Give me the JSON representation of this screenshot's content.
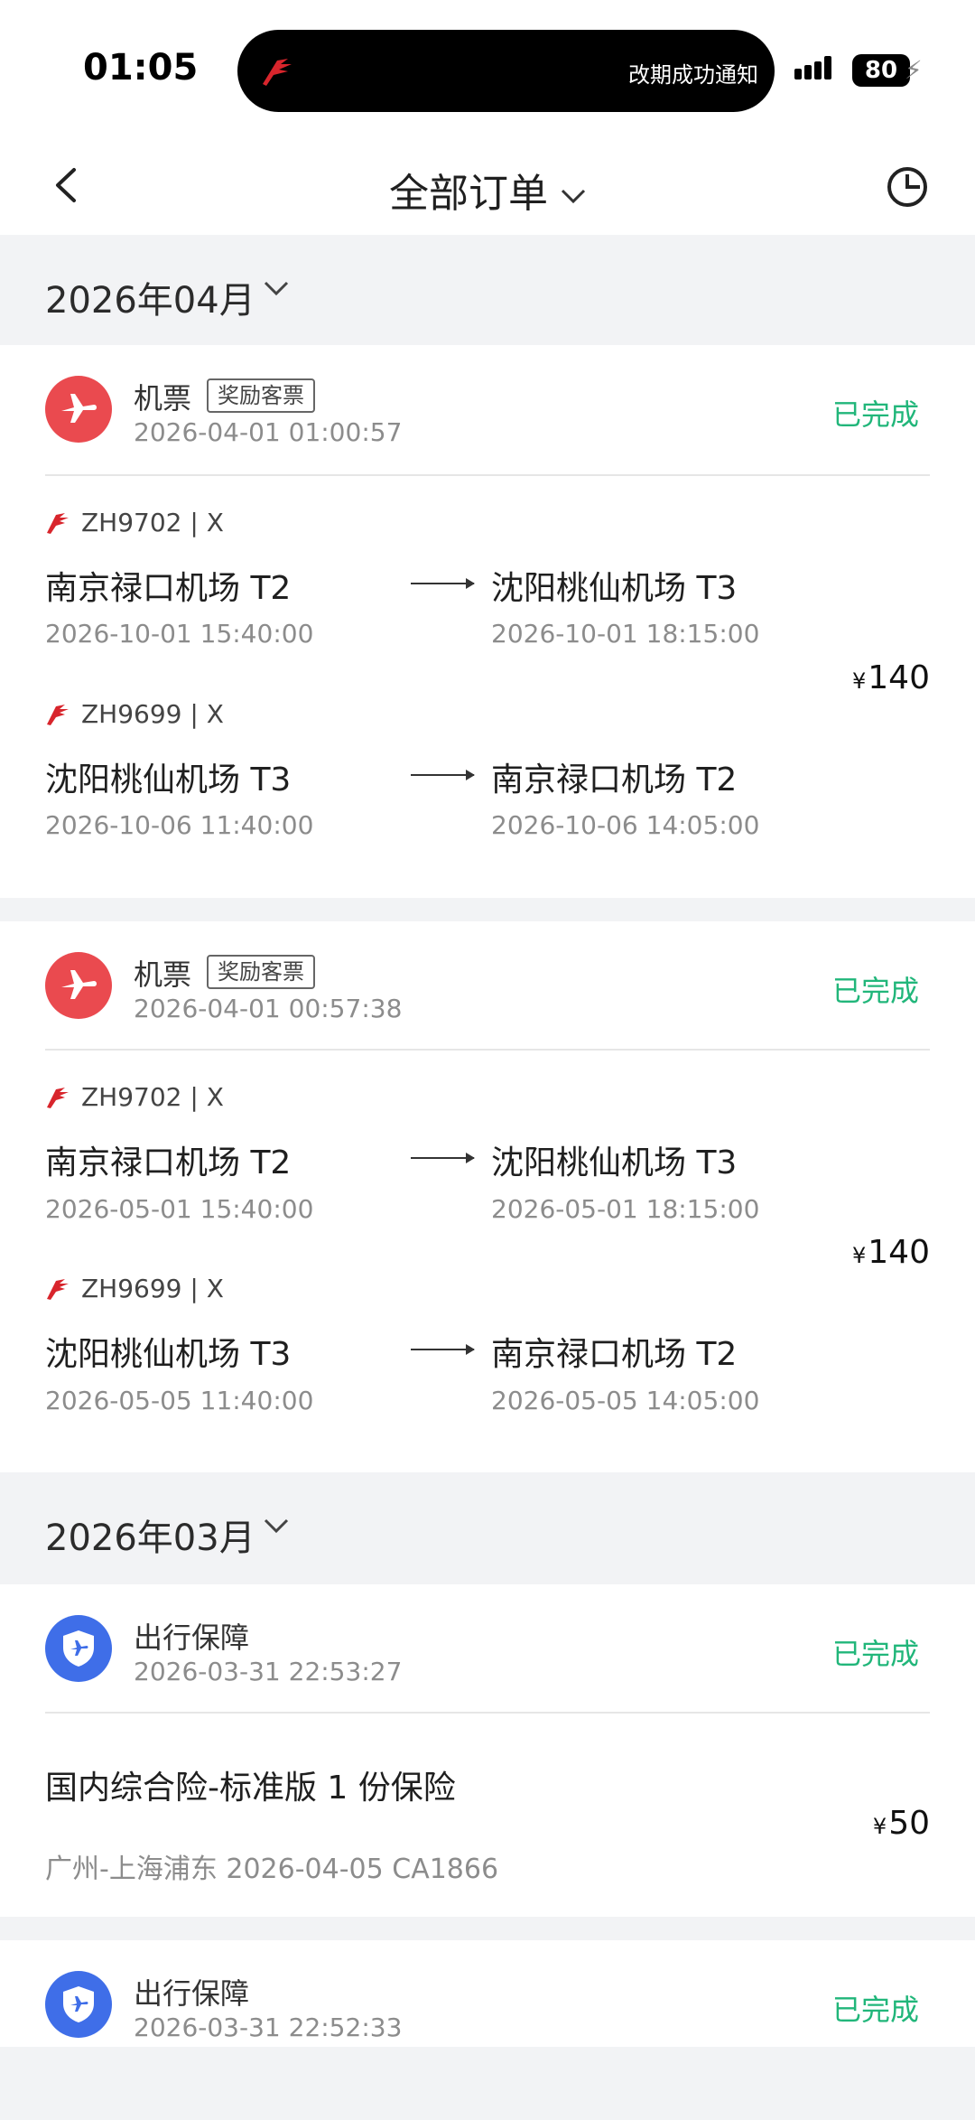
{
  "status_bar": {
    "time": "01:05",
    "notification": "改期成功通知",
    "battery": "80"
  },
  "nav": {
    "title": "全部订单"
  },
  "months": [
    {
      "label": "2026年04月"
    },
    {
      "label": "2026年03月"
    }
  ],
  "orders": [
    {
      "category": "机票",
      "badge": "奖励客票",
      "timestamp": "2026-04-01 01:00:57",
      "status": "已完成",
      "price_symbol": "¥",
      "price": "140",
      "flights": [
        {
          "code": "ZH9702 | X",
          "from": "南京禄口机场 T2",
          "from_time": "2026-10-01 15:40:00",
          "to": "沈阳桃仙机场 T3",
          "to_time": "2026-10-01 18:15:00"
        },
        {
          "code": "ZH9699 | X",
          "from": "沈阳桃仙机场 T3",
          "from_time": "2026-10-06 11:40:00",
          "to": "南京禄口机场 T2",
          "to_time": "2026-10-06 14:05:00"
        }
      ]
    },
    {
      "category": "机票",
      "badge": "奖励客票",
      "timestamp": "2026-04-01 00:57:38",
      "status": "已完成",
      "price_symbol": "¥",
      "price": "140",
      "flights": [
        {
          "code": "ZH9702 | X",
          "from": "南京禄口机场 T2",
          "from_time": "2026-05-01 15:40:00",
          "to": "沈阳桃仙机场 T3",
          "to_time": "2026-05-01 18:15:00"
        },
        {
          "code": "ZH9699 | X",
          "from": "沈阳桃仙机场 T3",
          "from_time": "2026-05-05 11:40:00",
          "to": "南京禄口机场 T2",
          "to_time": "2026-05-05 14:05:00"
        }
      ]
    },
    {
      "category": "出行保障",
      "timestamp": "2026-03-31 22:53:27",
      "status": "已完成",
      "title": "国内综合险-标准版 1 份保险",
      "subtitle": "广州-上海浦东 2026-04-05 CA1866",
      "price_symbol": "¥",
      "price": "50"
    },
    {
      "category": "出行保障",
      "timestamp": "2026-03-31 22:52:33",
      "status": "已完成"
    }
  ],
  "colors": {
    "status_green": "#21b67a",
    "flight_red": "#ea4a4f",
    "guard_blue": "#3f6ee8"
  },
  "icons": [
    "back-arrow-icon",
    "chevron-down-icon",
    "clock-icon",
    "airplane-icon",
    "shield-icon",
    "airline-logo-icon"
  ]
}
